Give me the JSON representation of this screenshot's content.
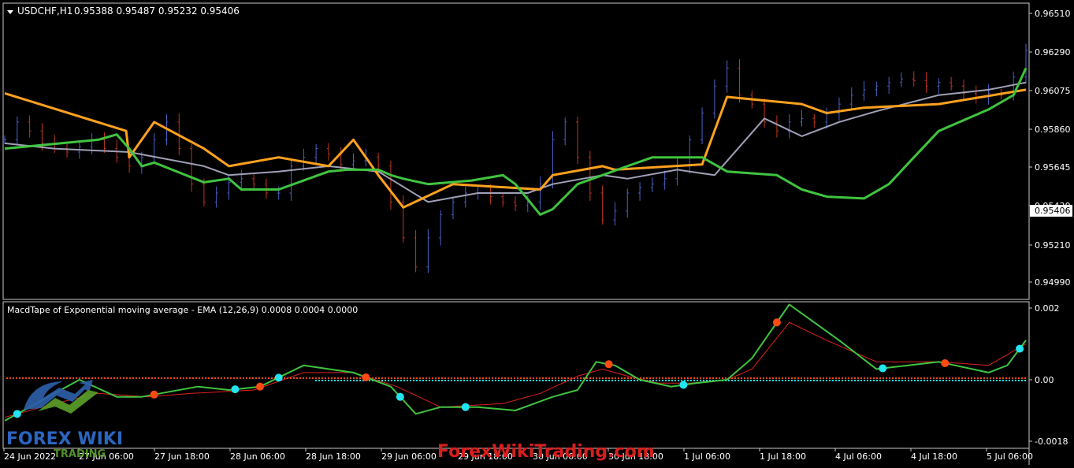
{
  "main_panel": {
    "symbol": "USDCHF,H1",
    "ohlc": "0.95388 0.95487 0.95232 0.95406",
    "current_price_label": "0.95406"
  },
  "indicator_panel": {
    "title": "MacdTape of Exponential moving average - EMA (12,26,9) 0.0008 0.0004 0.0000"
  },
  "watermark": {
    "logo_text": "FOREX WIKI",
    "logo_subtext": "TRADING",
    "site_text": "ForexWikiTrading.com"
  },
  "colors": {
    "background": "#000000",
    "bull_bar": "#4a63c9",
    "bear_bar": "#c0361c",
    "orange_line": "#ffa11e",
    "green_line": "#3fc43f",
    "gray_line": "#a0a0b8",
    "macd_line": "#3fc43f",
    "signal_line": "#e02020",
    "cyan_dot": "#22e4f2",
    "red_dot": "#ff4a12"
  },
  "chart_data": [
    {
      "type": "candlestick",
      "title": "USDCHF,H1",
      "ylim": [
        0.9485,
        0.9655
      ],
      "y_ticks": [
        "0.96510",
        "0.96290",
        "0.96075",
        "0.95860",
        "0.95645",
        "0.95430",
        "0.95210",
        "0.94990"
      ],
      "x_ticks": [
        "24 Jun 2022",
        "27 Jun 06:00",
        "27 Jun 18:00",
        "28 Jun 06:00",
        "28 Jun 18:00",
        "29 Jun 06:00",
        "29 Jun 18:00",
        "30 Jun 06:00",
        "30 Jun 18:00",
        "1 Jul 06:00",
        "1 Jul 18:00",
        "4 Jul 06:00",
        "4 Jul 18:00",
        "5 Jul 06:00"
      ],
      "series": [
        {
          "name": "close",
          "x": [
            0,
            4,
            8,
            12,
            16,
            20,
            24,
            28,
            32,
            36,
            40,
            44,
            48,
            52,
            56,
            60,
            64,
            68,
            72,
            76,
            80,
            84,
            88,
            92,
            96,
            100,
            104,
            108,
            112,
            116,
            120,
            124,
            128,
            132,
            136,
            140,
            144,
            148,
            152,
            156,
            160,
            164,
            168,
            172,
            176,
            180,
            184,
            188,
            192,
            196,
            200,
            204,
            208,
            212,
            216,
            220,
            224,
            228,
            232,
            236,
            240,
            244,
            248,
            252,
            256,
            260,
            264,
            268,
            272,
            276,
            280,
            284,
            288,
            292,
            296,
            300,
            304,
            308,
            312,
            316,
            320,
            324,
            328
          ],
          "values": [
            0.958,
            0.959,
            0.9585,
            0.9578,
            0.9575,
            0.9573,
            0.9576,
            0.958,
            0.9575,
            0.957,
            0.9565,
            0.957,
            0.958,
            0.959,
            0.9575,
            0.9555,
            0.9545,
            0.955,
            0.9556,
            0.9558,
            0.9555,
            0.955,
            0.955,
            0.9565,
            0.957,
            0.9575,
            0.9572,
            0.9566,
            0.9568,
            0.957,
            0.9565,
            0.9545,
            0.9525,
            0.9508,
            0.9525,
            0.9538,
            0.9545,
            0.955,
            0.955,
            0.9548,
            0.9545,
            0.9543,
            0.9545,
            0.9555,
            0.958,
            0.959,
            0.957,
            0.955,
            0.9535,
            0.954,
            0.955,
            0.9553,
            0.9555,
            0.9558,
            0.9565,
            0.958,
            0.9595,
            0.961,
            0.962,
            0.9605,
            0.96,
            0.959,
            0.9585,
            0.959,
            0.9592,
            0.959,
            0.9595,
            0.96,
            0.9605,
            0.9608,
            0.961,
            0.9612,
            0.9614,
            0.9613,
            0.961,
            0.9612,
            0.961,
            0.9606,
            0.9604,
            0.9606,
            0.9605,
            0.9615,
            0.963
          ]
        },
        {
          "name": "orange",
          "x": [
            0,
            39,
            40,
            48,
            64,
            72,
            88,
            104,
            112,
            120,
            128,
            144,
            172,
            176,
            192,
            196,
            224,
            232,
            256,
            264,
            276,
            300,
            328
          ],
          "values": [
            0.9606,
            0.9585,
            0.957,
            0.959,
            0.9575,
            0.9565,
            0.957,
            0.9565,
            0.958,
            0.956,
            0.9542,
            0.9555,
            0.9552,
            0.956,
            0.9565,
            0.9563,
            0.9566,
            0.9604,
            0.96,
            0.9595,
            0.9598,
            0.96,
            0.9608
          ]
        },
        {
          "name": "green",
          "x": [
            0,
            30,
            36,
            40,
            44,
            48,
            64,
            72,
            76,
            88,
            104,
            110,
            120,
            124,
            128,
            136,
            150,
            160,
            164,
            172,
            176,
            180,
            184,
            192,
            200,
            208,
            224,
            232,
            248,
            256,
            264,
            276,
            284,
            292,
            300,
            316,
            324,
            328
          ],
          "values": [
            0.9575,
            0.958,
            0.9583,
            0.9575,
            0.9565,
            0.9567,
            0.9556,
            0.9558,
            0.9552,
            0.9552,
            0.9562,
            0.9563,
            0.9563,
            0.956,
            0.9558,
            0.9555,
            0.9557,
            0.956,
            0.9555,
            0.9538,
            0.9541,
            0.9548,
            0.9555,
            0.956,
            0.9565,
            0.957,
            0.957,
            0.9562,
            0.956,
            0.9552,
            0.9548,
            0.9547,
            0.9555,
            0.957,
            0.9585,
            0.9597,
            0.9605,
            0.962
          ]
        },
        {
          "name": "gray",
          "x": [
            0,
            16,
            40,
            64,
            72,
            88,
            104,
            120,
            136,
            152,
            168,
            176,
            192,
            200,
            216,
            228,
            244,
            256,
            268,
            280,
            300,
            316,
            328
          ],
          "values": [
            0.9578,
            0.9575,
            0.9573,
            0.9565,
            0.956,
            0.9562,
            0.9565,
            0.9562,
            0.9545,
            0.955,
            0.955,
            0.9555,
            0.956,
            0.9558,
            0.9563,
            0.956,
            0.9592,
            0.9582,
            0.959,
            0.9596,
            0.9605,
            0.9608,
            0.9612
          ]
        }
      ]
    },
    {
      "type": "line",
      "title": "MacdTape of Exponential moving average - EMA (12,26,9)",
      "ylim": [
        -0.0019,
        0.0022
      ],
      "y_ticks": [
        "0.002",
        "0.00",
        "-0.0018"
      ],
      "series": [
        {
          "name": "macd",
          "x": [
            0,
            8,
            16,
            24,
            36,
            44,
            50,
            62,
            72,
            82,
            96,
            104,
            112,
            124,
            132,
            140,
            152,
            164,
            176,
            184,
            190,
            196,
            204,
            214,
            222,
            232,
            240,
            252,
            268,
            280,
            300,
            316,
            322,
            328
          ],
          "values": [
            -0.0012,
            -0.0008,
            -0.0004,
            0.0,
            -0.0005,
            -0.0005,
            -0.0004,
            -0.0002,
            -0.0003,
            -0.0002,
            0.0004,
            0.0003,
            0.0002,
            -0.0002,
            -0.001,
            -0.0008,
            -0.0008,
            -0.0009,
            -0.0005,
            -0.0003,
            0.0005,
            0.0004,
            0.0,
            -0.0002,
            -0.0001,
            0.0,
            0.0006,
            0.0021,
            0.0011,
            0.0003,
            0.0005,
            0.0002,
            0.0004,
            0.0011
          ]
        },
        {
          "name": "signal",
          "x": [
            0,
            16,
            30,
            46,
            60,
            80,
            96,
            112,
            126,
            140,
            160,
            172,
            184,
            192,
            200,
            210,
            220,
            232,
            240,
            252,
            264,
            280,
            300,
            316,
            328
          ],
          "values": [
            -0.0011,
            -0.0007,
            -0.0004,
            -0.0005,
            -0.0004,
            -0.0003,
            0.0002,
            0.0002,
            -0.0002,
            -0.0008,
            -0.0007,
            -0.0004,
            0.0001,
            0.0003,
            0.0001,
            -0.0001,
            -0.0001,
            0.0,
            0.0003,
            0.0016,
            0.0011,
            0.0005,
            0.0005,
            0.0004,
            0.001
          ]
        }
      ]
    }
  ]
}
